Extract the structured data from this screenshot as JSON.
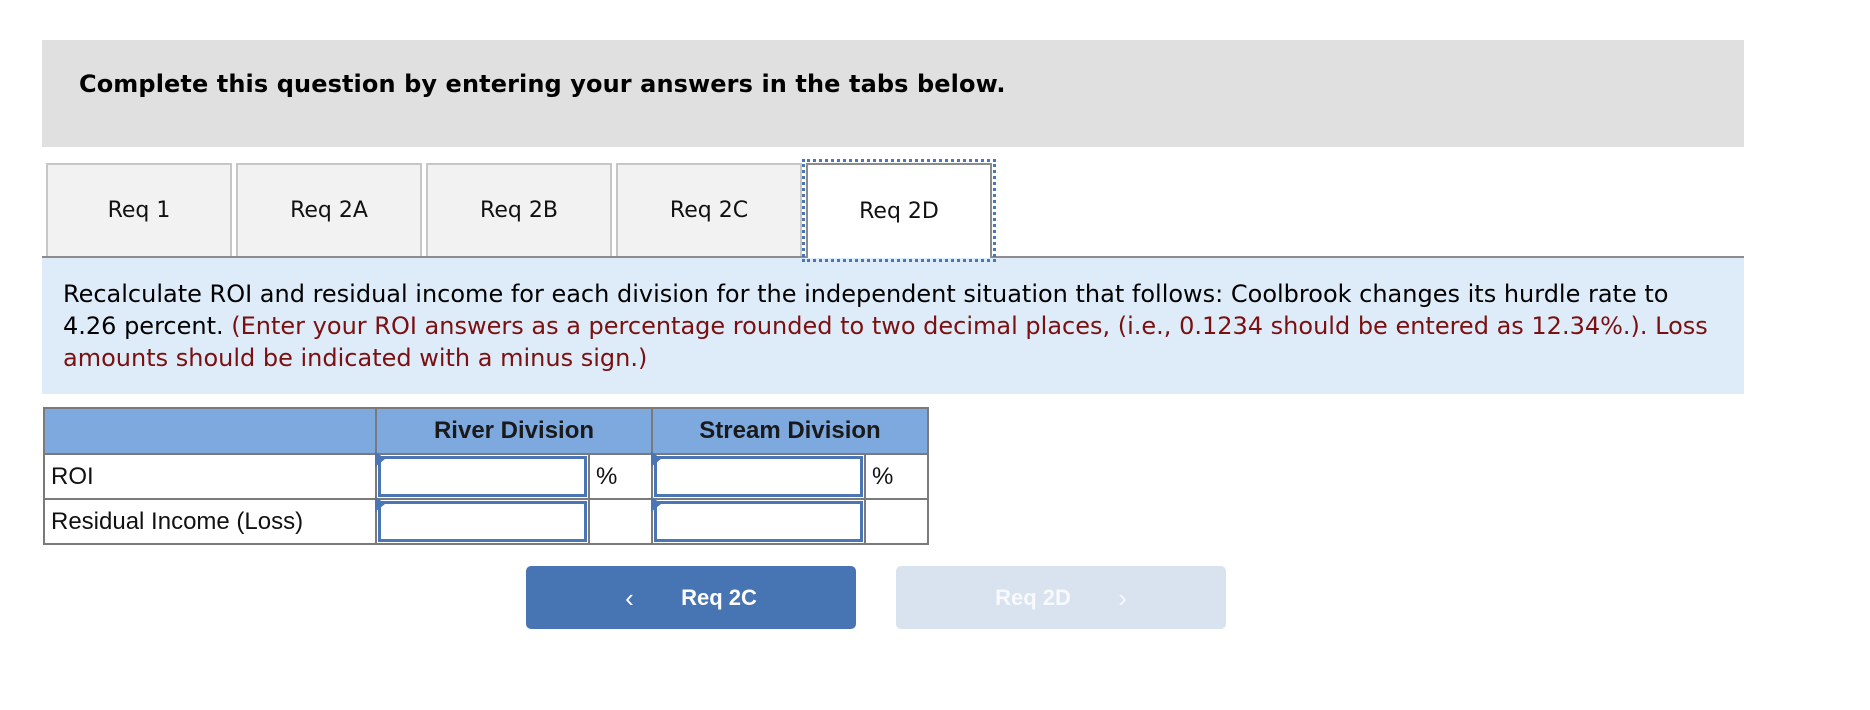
{
  "banner": {
    "text": "Complete this question by entering your answers in the tabs below."
  },
  "tabs": [
    {
      "label": "Req 1",
      "active": false
    },
    {
      "label": "Req 2A",
      "active": false
    },
    {
      "label": "Req 2B",
      "active": false
    },
    {
      "label": "Req 2C",
      "active": false
    },
    {
      "label": "Req 2D",
      "active": true
    }
  ],
  "instructions": {
    "main": "Recalculate ROI and residual income for each division for the independent situation that follows: Coolbrook changes its hurdle rate to 4.26 percent.",
    "note": "(Enter your ROI answers as a percentage rounded to two decimal places, (i.e., 0.1234 should be entered as 12.34%.). Loss amounts should be indicated with a minus sign.)"
  },
  "table": {
    "headers": [
      "",
      "River Division",
      "Stream Division"
    ],
    "rows": [
      {
        "label": "ROI",
        "river_value": "",
        "river_unit": "%",
        "stream_value": "",
        "stream_unit": "%"
      },
      {
        "label": "Residual Income (Loss)",
        "river_value": "",
        "river_unit": "",
        "stream_value": "",
        "stream_unit": ""
      }
    ]
  },
  "nav": {
    "prev": {
      "label": "Req 2C",
      "icon": "chevron-left-icon",
      "glyph": "‹"
    },
    "next": {
      "label": "Req 2D",
      "icon": "chevron-right-icon",
      "glyph": "›",
      "disabled": true
    }
  },
  "colors": {
    "banner_bg": "#e0e0e0",
    "instructions_bg": "#deebf8",
    "note_text": "#7a1010",
    "table_header_bg": "#7ea9df",
    "accent": "#4775b4",
    "disabled_button_bg": "#d9e3ef"
  }
}
